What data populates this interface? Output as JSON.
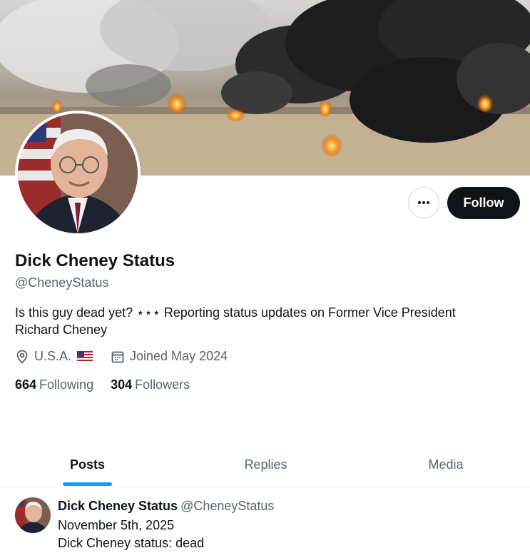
{
  "profile": {
    "name": "Dick Cheney Status",
    "handle": "@CheneyStatus",
    "bio_line1": "Is this guy dead yet? ⋆⋆⋆ Reporting status updates on Former Vice President",
    "bio_line2": "Richard Cheney",
    "location": "U.S.A.",
    "location_flag": "us-flag-icon",
    "joined": "Joined May 2024",
    "following_count": "664",
    "following_label": "Following",
    "followers_count": "304",
    "followers_label": "Followers"
  },
  "actions": {
    "more_icon": "more-dots-icon",
    "follow_label": "Follow"
  },
  "tabs": [
    {
      "label": "Posts",
      "active": true
    },
    {
      "label": "Replies",
      "active": false
    },
    {
      "label": "Media",
      "active": false
    }
  ],
  "post": {
    "author_name": "Dick Cheney Status",
    "author_handle": "@CheneyStatus",
    "line1": "November 5th, 2025",
    "line2": "Dick Cheney status: dead"
  },
  "colors": {
    "follow_bg": "#0f1419",
    "accent": "#1d9bf0",
    "secondary_text": "#536471"
  }
}
